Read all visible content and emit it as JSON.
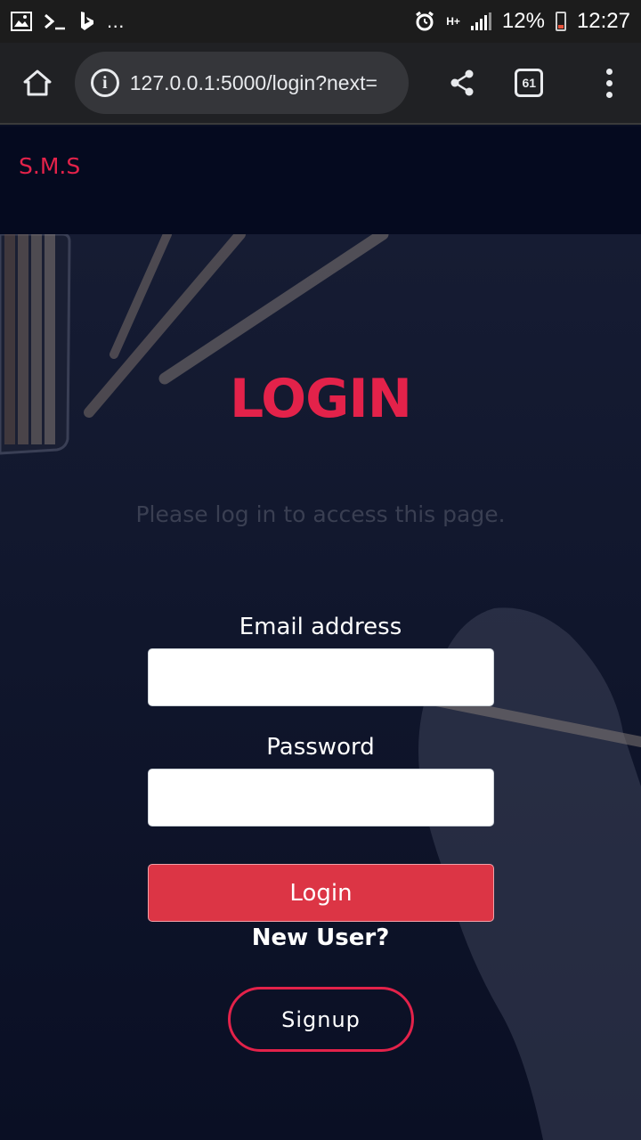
{
  "status_bar": {
    "left_overflow": "...",
    "battery_percent": "12%",
    "time": "12:27",
    "network": "H+",
    "icons": [
      "gallery-icon",
      "terminal-icon",
      "bing-icon",
      "alarm-icon",
      "signal-icon",
      "battery-icon"
    ]
  },
  "browser": {
    "url": "127.0.0.1:5000/login?next=",
    "tab_count": "61",
    "icons": [
      "home-icon",
      "info-icon",
      "share-icon",
      "tabs-icon",
      "menu-icon"
    ]
  },
  "navbar": {
    "brand": "S.M.S"
  },
  "login": {
    "title": "LOGIN",
    "flash_message": "Please log in to access this page.",
    "email_label": "Email address",
    "email_value": "",
    "password_label": "Password",
    "password_value": "",
    "submit_label": "Login",
    "new_user_text": "New User?",
    "signup_label": "Signup"
  },
  "colors": {
    "accent": "#e3224a",
    "button": "#dc3545",
    "background": "#0a0f24",
    "toolbar": "#202124"
  }
}
